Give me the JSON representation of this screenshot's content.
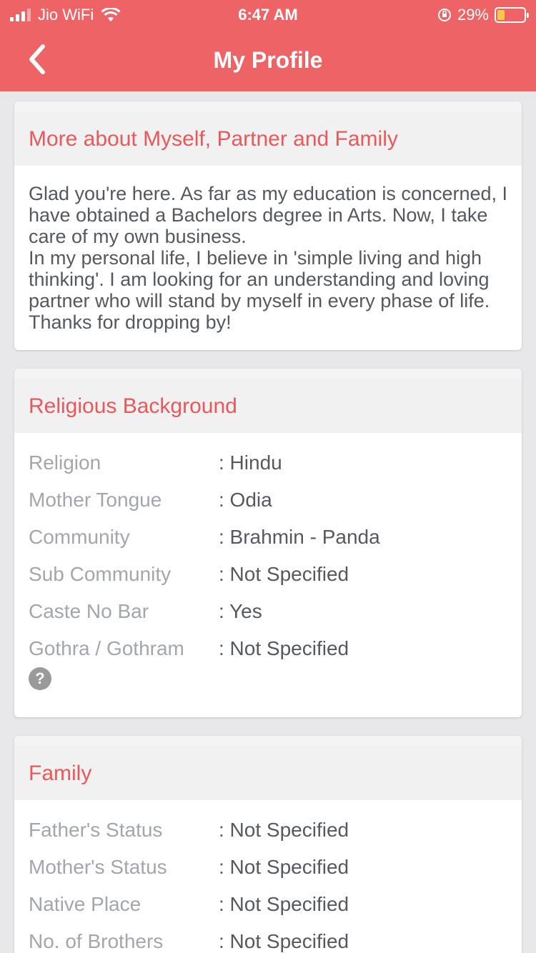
{
  "status_bar": {
    "carrier": "Jio WiFi",
    "time": "6:47 AM",
    "battery": "29%",
    "battery_level": 0.29
  },
  "header": {
    "title": "My Profile"
  },
  "about": {
    "heading": "More about Myself, Partner and Family",
    "text": "Glad you're here. As far as my education is concerned, I have obtained a Bachelors degree in Arts. Now, I take care of my own business.\nIn my personal life, I believe in 'simple living and high thinking'. I am looking for an understanding and loving partner who will stand by myself in every phase of life. Thanks for dropping by!"
  },
  "religious": {
    "heading": "Religious Background",
    "rows": [
      {
        "label": "Religion",
        "value": ": Hindu"
      },
      {
        "label": "Mother Tongue",
        "value": ": Odia"
      },
      {
        "label": "Community",
        "value": ": Brahmin - Panda"
      },
      {
        "label": "Sub Community",
        "value": ": Not Specified"
      },
      {
        "label": "Caste No Bar",
        "value": ": Yes"
      },
      {
        "label": "Gothra / Gothram",
        "value": ": Not Specified"
      }
    ],
    "help_icon": "?"
  },
  "family": {
    "heading": "Family",
    "rows": [
      {
        "label": "Father's Status",
        "value": ": Not Specified"
      },
      {
        "label": "Mother's Status",
        "value": ": Not Specified"
      },
      {
        "label": "Native Place",
        "value": ": Not Specified"
      },
      {
        "label": "No. of Brothers",
        "value": ": Not Specified"
      }
    ]
  },
  "colors": {
    "accent": "#ee6466",
    "heading": "#e9595b"
  }
}
